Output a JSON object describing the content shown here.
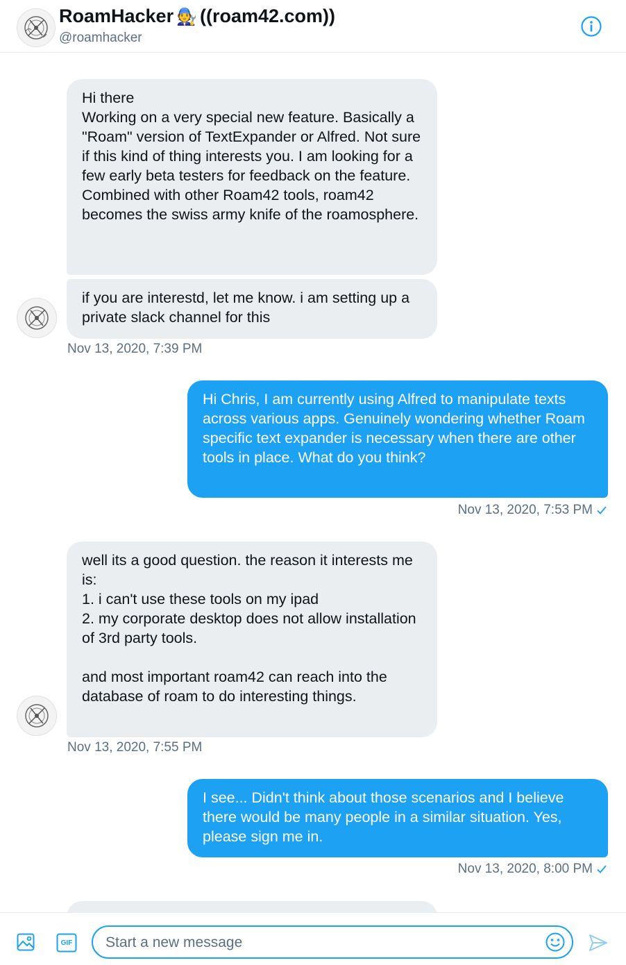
{
  "header": {
    "name": "RoamHacker",
    "name_emoji": "🧑‍🔧",
    "name_suffix": "((roam42.com))",
    "handle": "@roamhacker",
    "info_icon": "info-icon"
  },
  "messages": [
    {
      "direction": "in",
      "text": "Hi there\nWorking on a very special new feature. Basically a \"Roam\" version of TextExpander or Alfred. Not sure if this kind of thing interests you. I am looking for a few early beta testers for feedback on the feature. Combined with other Roam42 tools, roam42 becomes the swiss army knife of the roamosphere."
    },
    {
      "direction": "in",
      "text": "if you are interestd, let me know. i am setting up a private slack channel for this",
      "timestamp": "Nov 13, 2020, 7:39 PM"
    },
    {
      "direction": "out",
      "text": "Hi Chris, I am currently using Alfred to manipulate texts across various apps. Genuinely wondering whether Roam specific text expander is necessary when there are other tools in place. What do you think?",
      "timestamp": "Nov 13, 2020, 7:53 PM"
    },
    {
      "direction": "in",
      "text": "well its a good question. the reason it interests me is:\n1. i can't use these tools on my ipad\n2. my corporate desktop does not allow installation of 3rd party tools.\n\nand most important roam42 can reach into the database of roam to do interesting things.",
      "timestamp": "Nov 13, 2020, 7:55 PM"
    },
    {
      "direction": "out",
      "text": "I see... Didn't think about those scenarios and I believe there would be many people in a similar situation. Yes, please sign me in.",
      "timestamp": "Nov 13, 2020, 8:00 PM"
    }
  ],
  "composer": {
    "placeholder": "Start a new message",
    "image_icon": "image-icon",
    "gif_label": "GIF",
    "emoji_icon": "emoji-icon",
    "send_icon": "send-icon"
  },
  "colors": {
    "accent": "#1da1f2",
    "incoming_bubble": "#ebeef0",
    "secondary_text": "#5b7083"
  }
}
